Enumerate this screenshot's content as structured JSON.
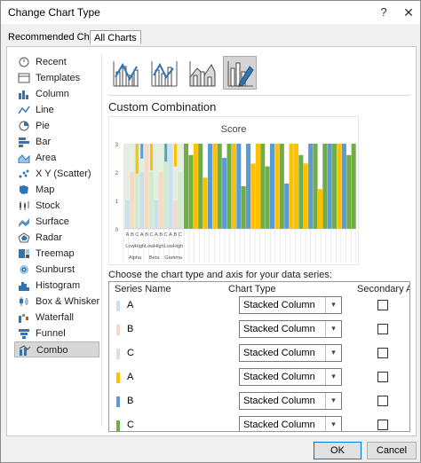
{
  "window": {
    "title": "Change Chart Type",
    "help_glyph": "?",
    "close_glyph": "✕"
  },
  "tabs": {
    "recommended": "Recommended Charts",
    "all": "All Charts"
  },
  "sidebar": {
    "items": [
      {
        "label": "Recent",
        "icon": "recent-icon"
      },
      {
        "label": "Templates",
        "icon": "templates-icon"
      },
      {
        "label": "Column",
        "icon": "column-chart-icon"
      },
      {
        "label": "Line",
        "icon": "line-chart-icon"
      },
      {
        "label": "Pie",
        "icon": "pie-chart-icon"
      },
      {
        "label": "Bar",
        "icon": "bar-chart-icon"
      },
      {
        "label": "Area",
        "icon": "area-chart-icon"
      },
      {
        "label": "X Y (Scatter)",
        "icon": "scatter-chart-icon"
      },
      {
        "label": "Map",
        "icon": "map-chart-icon"
      },
      {
        "label": "Stock",
        "icon": "stock-chart-icon"
      },
      {
        "label": "Surface",
        "icon": "surface-chart-icon"
      },
      {
        "label": "Radar",
        "icon": "radar-chart-icon"
      },
      {
        "label": "Treemap",
        "icon": "treemap-chart-icon"
      },
      {
        "label": "Sunburst",
        "icon": "sunburst-chart-icon"
      },
      {
        "label": "Histogram",
        "icon": "histogram-chart-icon"
      },
      {
        "label": "Box & Whisker",
        "icon": "box-whisker-chart-icon"
      },
      {
        "label": "Waterfall",
        "icon": "waterfall-chart-icon"
      },
      {
        "label": "Funnel",
        "icon": "funnel-chart-icon"
      },
      {
        "label": "Combo",
        "icon": "combo-chart-icon",
        "selected": true
      }
    ]
  },
  "subtypes": [
    {
      "name": "clustered-column-line-icon"
    },
    {
      "name": "clustered-column-line-secondary-axis-icon"
    },
    {
      "name": "stacked-area-clustered-column-icon"
    },
    {
      "name": "custom-combination-icon",
      "selected": true
    }
  ],
  "section_title": "Custom Combination",
  "colors": {
    "light_blue": "#c9dff2",
    "light_orange": "#f9d9c4",
    "light_green": "#d2ebcf",
    "yellow": "#ffc000",
    "blue": "#5b9bd5",
    "green": "#70ad47",
    "accent": "#0078d7"
  },
  "chart_data": {
    "type": "bar",
    "title": "Score",
    "ylim": [
      0,
      3
    ],
    "yticks": [
      "0",
      "1",
      "2",
      "3"
    ],
    "categories_level1": [
      "A",
      "B",
      "C",
      "A",
      "B",
      "C",
      "A",
      "B",
      "C",
      "A",
      "B",
      "C"
    ],
    "categories_level2": [
      "Low",
      "High",
      "Low",
      "High",
      "Low",
      "High"
    ],
    "categories_level3": [
      "Alpha",
      "Beta",
      "Gamma"
    ],
    "series": [
      {
        "name": "A",
        "values": [
          1,
          0,
          0,
          2,
          0,
          0,
          1,
          0,
          0,
          3,
          0,
          0
        ]
      },
      {
        "name": "B",
        "values": [
          0,
          2,
          0,
          0,
          3,
          0,
          0,
          2,
          0,
          0,
          1,
          0
        ]
      },
      {
        "name": "C",
        "values": [
          0,
          0,
          3,
          0,
          0,
          2,
          0,
          0,
          3,
          0,
          0,
          2
        ]
      }
    ],
    "extra_columns": {
      "colors": [
        "green",
        "green",
        "yellow",
        "green",
        "yellow",
        "blue",
        "yellow",
        "green",
        "blue",
        "green",
        "yellow",
        "blue",
        "green",
        "blue",
        "yellow",
        "yellow",
        "green",
        "green",
        "blue",
        "yellow",
        "green",
        "blue",
        "yellow",
        "yellow",
        "green",
        "yellow",
        "blue",
        "green",
        "yellow",
        "green",
        "blue",
        "green",
        "yellow",
        "blue",
        "green",
        "green"
      ],
      "values": [
        3,
        2.6,
        3,
        3,
        1.8,
        3,
        3,
        3,
        2.5,
        3,
        3,
        3,
        1.5,
        3,
        2.3,
        3,
        3,
        2.2,
        3,
        3,
        3,
        1.6,
        3,
        3,
        2.6,
        2.3,
        3,
        3,
        1.4,
        3,
        3,
        3,
        3,
        3,
        2.6,
        3
      ]
    }
  },
  "series_panel": {
    "prompt": "Choose the chart type and axis for your data series:",
    "headers": {
      "name": "Series Name",
      "type": "Chart Type",
      "axis": "Secondary Axis"
    },
    "rows": [
      {
        "name": "A",
        "color": "#c9dff2",
        "type": "Stacked Column",
        "secondary": false
      },
      {
        "name": "B",
        "color": "#f9d9c4",
        "type": "Stacked Column",
        "secondary": false
      },
      {
        "name": "C",
        "color": "#d2ebcf",
        "type": "Stacked Column",
        "secondary": false
      },
      {
        "name": "A",
        "color": "#ffc000",
        "type": "Stacked Column",
        "secondary": false
      },
      {
        "name": "B",
        "color": "#5b9bd5",
        "type": "Stacked Column",
        "secondary": false
      },
      {
        "name": "C",
        "color": "#70ad47",
        "type": "Stacked Column",
        "secondary": false
      }
    ]
  },
  "footer": {
    "ok": "OK",
    "cancel": "Cancel"
  }
}
